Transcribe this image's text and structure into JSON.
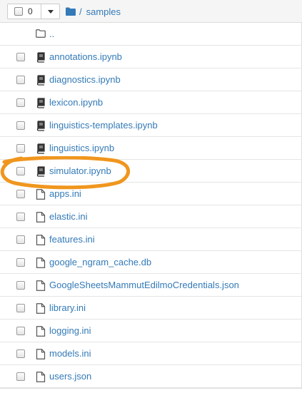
{
  "header": {
    "selected_count": "0",
    "breadcrumb_separator": "/",
    "breadcrumb_folder": "samples"
  },
  "files": [
    {
      "name": "..",
      "type": "folder"
    },
    {
      "name": "annotations.ipynb",
      "type": "notebook"
    },
    {
      "name": "diagnostics.ipynb",
      "type": "notebook"
    },
    {
      "name": "lexicon.ipynb",
      "type": "notebook"
    },
    {
      "name": "linguistics-templates.ipynb",
      "type": "notebook"
    },
    {
      "name": "linguistics.ipynb",
      "type": "notebook"
    },
    {
      "name": "simulator.ipynb",
      "type": "notebook"
    },
    {
      "name": "apps.ini",
      "type": "file"
    },
    {
      "name": "elastic.ini",
      "type": "file"
    },
    {
      "name": "features.ini",
      "type": "file"
    },
    {
      "name": "google_ngram_cache.db",
      "type": "file"
    },
    {
      "name": "GoogleSheetsMammutEdilmoCredentials.json",
      "type": "file"
    },
    {
      "name": "library.ini",
      "type": "file"
    },
    {
      "name": "logging.ini",
      "type": "file"
    },
    {
      "name": "models.ini",
      "type": "file"
    },
    {
      "name": "users.json",
      "type": "file"
    }
  ],
  "colors": {
    "link": "#337ab7",
    "annotation": "#f0961e"
  }
}
